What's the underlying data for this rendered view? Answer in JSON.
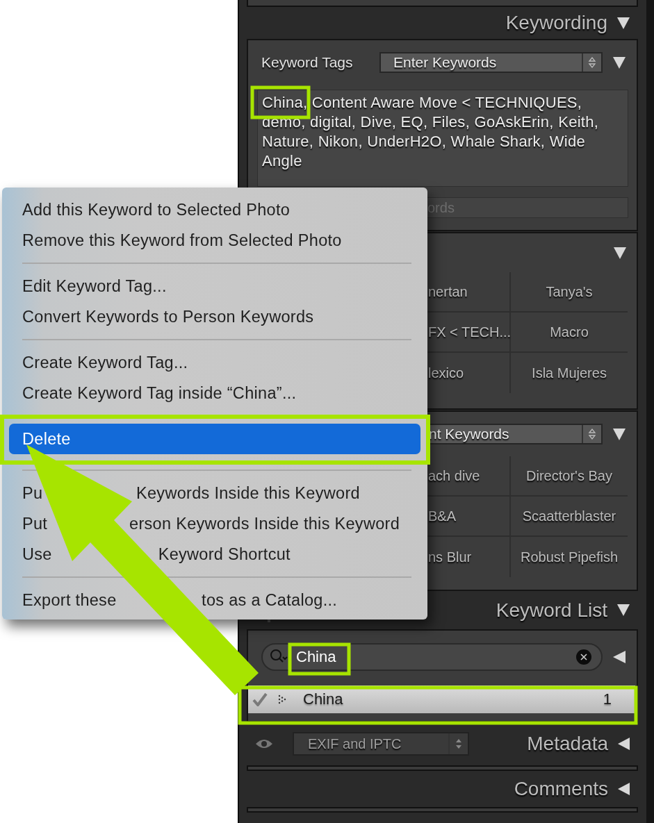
{
  "panel": {
    "keywording": {
      "title": "Keywording",
      "expanded": true,
      "keyword_tags": {
        "label": "Keyword Tags",
        "dropdown": "Enter Keywords",
        "expanded": true
      },
      "tags_text": "China, Content Aware Move < TECHNIQUES, demo, digital, Dive, EQ, Files, GoAskErin, Keith, Nature, Nikon, UnderH2O, Whale Shark, Wide Angle",
      "add_field": {
        "placeholder": "ords"
      },
      "suggestions": {
        "expanded": true,
        "cells": [
          [
            "nertan",
            "Tanya's"
          ],
          [
            "FX < TECH...",
            "Macro"
          ],
          [
            "lexico",
            "Isla Mujeres"
          ]
        ]
      },
      "keyword_set": {
        "dropdown": "nt Keywords",
        "expanded": true,
        "cells": [
          [
            "ach dive",
            "Director's Bay"
          ],
          [
            "B&A",
            "Scaatterblaster"
          ],
          [
            "ns Blur",
            "Robust Pipefish"
          ]
        ]
      }
    },
    "keyword_list": {
      "title": "Keyword List",
      "expanded": true,
      "search": {
        "value": "China"
      },
      "rows": [
        {
          "name": "China",
          "count": "1",
          "checked": true,
          "selected": true
        }
      ]
    },
    "metadata": {
      "title": "Metadata",
      "preset": "EXIF and IPTC",
      "expanded": false
    },
    "comments": {
      "title": "Comments",
      "expanded": false
    }
  },
  "context_menu": {
    "groups": [
      [
        {
          "label": "Add this Keyword to Selected Photo",
          "selected": false
        },
        {
          "label": "Remove this Keyword from Selected Photo",
          "selected": false
        }
      ],
      [
        {
          "label": "Edit Keyword Tag...",
          "selected": false
        },
        {
          "label": "Convert Keywords to Person Keywords",
          "selected": false
        }
      ],
      [
        {
          "label": "Create Keyword Tag...",
          "selected": false
        },
        {
          "label": "Create Keyword Tag inside “China”...",
          "selected": false
        },
        {
          "label": "Delete",
          "selected": true
        }
      ],
      [
        {
          "parts": [
            "Pu",
            "Keywords Inside this Keyword"
          ],
          "selected": false
        },
        {
          "parts": [
            "Put",
            "erson Keywords Inside this Keyword"
          ],
          "selected": false
        },
        {
          "parts": [
            "Use",
            "Keyword Shortcut"
          ],
          "selected": false
        }
      ],
      [
        {
          "parts": [
            "Export these",
            "tos as a Catalog..."
          ],
          "selected": false
        }
      ]
    ]
  }
}
